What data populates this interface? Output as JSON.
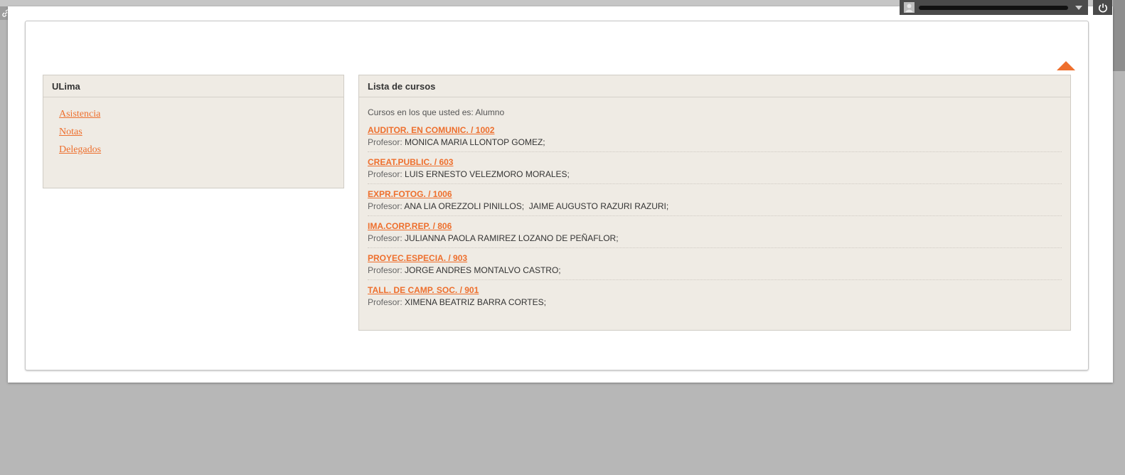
{
  "left_panel": {
    "title": "ULima",
    "links": [
      "Asistencia",
      "Notas",
      "Delegados"
    ]
  },
  "courses_panel": {
    "title": "Lista de cursos",
    "intro": "Cursos en los que usted es: Alumno",
    "professor_label": "Profesor:",
    "courses": [
      {
        "name": "AUDITOR. EN COMUNIC. / 1002",
        "professors": "MONICA MARIA LLONTOP GOMEZ;"
      },
      {
        "name": "CREAT.PUBLIC. / 603",
        "professors": "LUIS ERNESTO VELEZMORO MORALES;"
      },
      {
        "name": "EXPR.FOTOG. / 1006",
        "professors": "ANA LIA OREZZOLI PINILLOS;  JAIME AUGUSTO RAZURI RAZURI;"
      },
      {
        "name": "IMA.CORP.REP. / 806",
        "professors": "JULIANNA PAOLA RAMIREZ LOZANO DE PEÑAFLOR;"
      },
      {
        "name": "PROYEC.ESPECIA. / 903",
        "professors": "JORGE ANDRES MONTALVO CASTRO;"
      },
      {
        "name": "TALL. DE CAMP. SOC. / 901",
        "professors": "XIMENA BEATRIZ BARRA CORTES;"
      }
    ]
  },
  "user_menu": {
    "avatar_icon": "user-avatar-icon",
    "dropdown_icon": "chevron-down-icon",
    "power_icon": "power-icon"
  },
  "icons": {
    "top_left": "link-icon",
    "collapse": "collapse-up-arrow-icon"
  },
  "colors": {
    "accent": "#ee6f2d",
    "panel_bg": "#efebe4",
    "page_bg": "#b7b7b7",
    "topbar": "#4a4a4a"
  }
}
